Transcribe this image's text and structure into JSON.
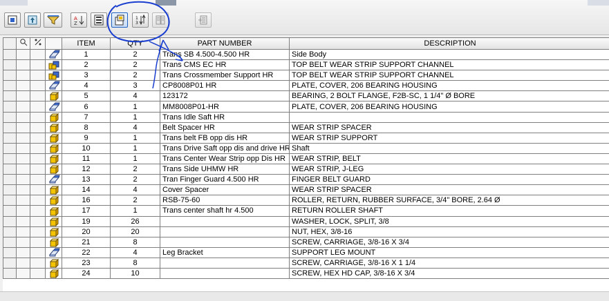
{
  "toolbar": {
    "buttons": [
      {
        "name": "view-options-button",
        "icon": "view-options-icon"
      },
      {
        "name": "export-button",
        "icon": "export-icon"
      },
      {
        "name": "filter-button",
        "icon": "filter-icon"
      },
      {
        "name": "sort-button",
        "icon": "sort-az-icon"
      },
      {
        "name": "bom-settings-button",
        "icon": "bom-settings-icon"
      },
      {
        "name": "part-properties-button",
        "icon": "part-properties-icon"
      },
      {
        "name": "renumber-items-button",
        "icon": "renumber-icon"
      },
      {
        "name": "compare-button",
        "icon": "compare-icon"
      },
      {
        "name": "expand-button",
        "icon": "expand-icon"
      }
    ]
  },
  "table": {
    "headers": {
      "item": "ITEM",
      "qty": "QTY",
      "part_number": "PART NUMBER",
      "description": "DESCRIPTION"
    },
    "rows": [
      {
        "item": "1",
        "qty": "2",
        "part": "Trans SB 4.500-4.500 HR",
        "desc": "Side Body",
        "icon": "part"
      },
      {
        "item": "2",
        "qty": "2",
        "part": "Trans CMS EC HR",
        "desc": "TOP BELT WEAR STRIP SUPPORT CHANNEL",
        "icon": "assembly"
      },
      {
        "item": "3",
        "qty": "2",
        "part": "Trans Crossmember Support HR",
        "desc": "TOP BELT WEAR STRIP SUPPORT CHANNEL",
        "icon": "assembly"
      },
      {
        "item": "4",
        "qty": "3",
        "part": "CP8008P01 HR",
        "desc": "PLATE, COVER, 206 BEARING HOUSING",
        "icon": "part"
      },
      {
        "item": "5",
        "qty": "4",
        "part": "123172",
        "desc": "BEARING, 2 BOLT FLANGE, F2B-SC, 1 1/4\" Ø BORE",
        "icon": "box"
      },
      {
        "item": "6",
        "qty": "1",
        "part": "MM8008P01-HR",
        "desc": "PLATE, COVER, 206 BEARING HOUSING",
        "icon": "part"
      },
      {
        "item": "7",
        "qty": "1",
        "part": "Trans Idle Saft HR",
        "desc": "",
        "icon": "box"
      },
      {
        "item": "8",
        "qty": "4",
        "part": "Belt Spacer HR",
        "desc": "WEAR STRIP SPACER",
        "icon": "box"
      },
      {
        "item": "9",
        "qty": "1",
        "part": "Trans belt FB opp dis HR",
        "desc": "WEAR STRIP SUPPORT",
        "icon": "box"
      },
      {
        "item": "10",
        "qty": "1",
        "part": "Trans Drive Saft opp dis and drive HR",
        "desc": "Shaft",
        "icon": "box"
      },
      {
        "item": "11",
        "qty": "1",
        "part": "Trans Center Wear Strip opp Dis HR",
        "desc": "WEAR STRIP, BELT",
        "icon": "box"
      },
      {
        "item": "12",
        "qty": "2",
        "part": "Trans Side UHMW HR",
        "desc": "WEAR STRIP, J-LEG",
        "icon": "box"
      },
      {
        "item": "13",
        "qty": "2",
        "part": "Tran Finger Guard 4.500 HR",
        "desc": "FINGER BELT GUARD",
        "icon": "part"
      },
      {
        "item": "14",
        "qty": "4",
        "part": "Cover Spacer",
        "desc": "WEAR STRIP SPACER",
        "icon": "box"
      },
      {
        "item": "16",
        "qty": "2",
        "part": "RSB-75-60",
        "desc": "ROLLER, RETURN, RUBBER SURFACE, 3/4\" BORE, 2.64 Ø",
        "icon": "box"
      },
      {
        "item": "17",
        "qty": "1",
        "part": "Trans center shaft hr 4.500",
        "desc": "RETURN ROLLER SHAFT",
        "icon": "box"
      },
      {
        "item": "19",
        "qty": "26",
        "part": "",
        "desc": "WASHER, LOCK, SPLIT, 3/8",
        "icon": "box"
      },
      {
        "item": "20",
        "qty": "20",
        "part": "",
        "desc": "NUT, HEX, 3/8-16",
        "icon": "box"
      },
      {
        "item": "21",
        "qty": "8",
        "part": "",
        "desc": "SCREW, CARRIAGE, 3/8-16 X 3/4",
        "icon": "box"
      },
      {
        "item": "22",
        "qty": "4",
        "part": "Leg Bracket",
        "desc": "SUPPORT LEG MOUNT",
        "icon": "part"
      },
      {
        "item": "23",
        "qty": "8",
        "part": "",
        "desc": "SCREW, CARRIAGE, 3/8-16 X 1 1/4",
        "icon": "box"
      },
      {
        "item": "24",
        "qty": "10",
        "part": "",
        "desc": "SCREW, HEX HD CAP, 3/8-16 X 3/4",
        "icon": "box"
      }
    ]
  },
  "colors": {
    "annotation": "#1a3fd0",
    "part_icon_yellow": "#f5c400",
    "part_icon_blue": "#3a67c8"
  }
}
